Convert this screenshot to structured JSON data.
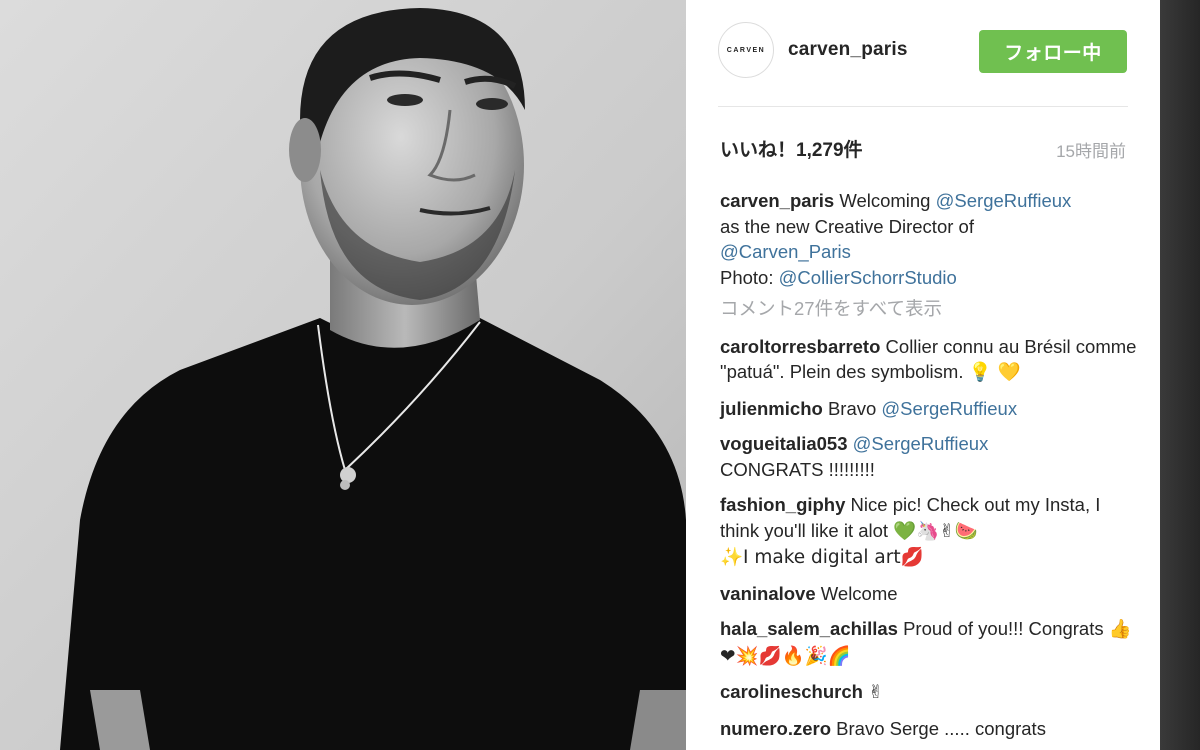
{
  "post": {
    "account": {
      "avatar_text": "CARVEN",
      "username": "carven_paris",
      "follow_label": "フォロー中"
    },
    "likes_text": "いいね！1,279件",
    "timestamp": "15時間前",
    "caption": {
      "user": "carven_paris",
      "text1": "Welcoming",
      "mention1": "@SergeRuffieux",
      "text2": "as the new Creative Director of",
      "mention2": "@Carven_Paris",
      "text3": "Photo:",
      "mention3": "@CollierSchorrStudio"
    },
    "view_all_comments": "コメント27件をすべて表示",
    "comments": [
      {
        "user": "caroltorresbarreto",
        "text": "Collier connu au Brésil comme \"patuá\". Plein des symbolism.",
        "emoji": "💡 💛"
      },
      {
        "user": "julienmicho",
        "text": "Bravo",
        "mention": "@SergeRuffieux"
      },
      {
        "user": "vogueitalia053",
        "mention": "@SergeRuffieux",
        "text": "CONGRATS !!!!!!!!!"
      },
      {
        "user": "fashion_giphy",
        "text": "Nice pic! Check out my Insta, I think you'll like it alot",
        "emoji": "💚🦄✌🍉",
        "text2": "✨I make digital art💋"
      },
      {
        "user": "vaninalove",
        "text": "Welcome"
      },
      {
        "user": "hala_salem_achillas",
        "text": "Proud of you!!! Congrats",
        "emoji": "👍❤💥💋🔥🎉🌈"
      },
      {
        "user": "carolineschurch",
        "emoji": "✌"
      },
      {
        "user": "numero.zero",
        "text": "Bravo Serge ..... congrats"
      }
    ],
    "colors": {
      "follow_green": "#70c050",
      "mention_blue": "#3f729b",
      "muted_gray": "#a5a7aa",
      "text_dark": "#262626"
    }
  }
}
